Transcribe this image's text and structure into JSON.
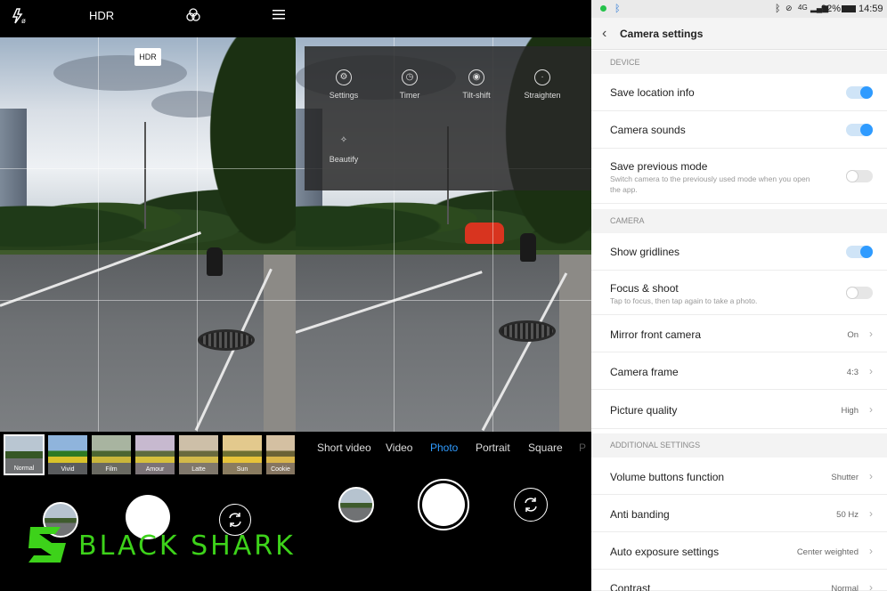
{
  "panel_left": {
    "topbar": {
      "flash_icon": "flash-auto-icon",
      "hdr_label": "HDR",
      "filter_icon": "filter-circles-icon",
      "menu_icon": "hamburger-menu-icon"
    },
    "hdr_badge": "HDR",
    "filters": [
      "Normal",
      "Vivid",
      "Film",
      "Amour",
      "Latte",
      "Sun",
      "Cookie"
    ],
    "selected_filter": "Normal",
    "brand": {
      "text": "BLACK SHARK",
      "color": "#3dd21a"
    }
  },
  "panel_middle": {
    "menu": {
      "items": [
        {
          "label": "Settings",
          "icon": "gear-icon"
        },
        {
          "label": "Timer",
          "icon": "clock-icon"
        },
        {
          "label": "Tilt-shift",
          "icon": "tilt-shift-icon"
        },
        {
          "label": "Straighten",
          "icon": "straighten-icon"
        },
        {
          "label": "Beautify",
          "icon": "sparkle-icon"
        }
      ]
    },
    "modes": [
      "Short video",
      "Video",
      "Photo",
      "Portrait",
      "Square",
      "P"
    ],
    "active_mode": "Photo",
    "accent": "#2f9bff"
  },
  "panel_right": {
    "statusbar": {
      "battery": "92%",
      "time": "14:59",
      "network": "4G"
    },
    "header": {
      "title": "Camera settings"
    },
    "sections": {
      "device": "DEVICE",
      "camera": "CAMERA",
      "additional": "ADDITIONAL SETTINGS"
    },
    "rows": {
      "save_location": {
        "label": "Save location info",
        "on": true
      },
      "camera_sounds": {
        "label": "Camera sounds",
        "on": true
      },
      "save_previous": {
        "label": "Save previous mode",
        "desc": "Switch camera to the previously used mode when you open the app.",
        "on": false
      },
      "gridlines": {
        "label": "Show gridlines",
        "on": true
      },
      "focus_shoot": {
        "label": "Focus & shoot",
        "desc": "Tap to focus, then tap again to take a photo.",
        "on": false
      },
      "mirror": {
        "label": "Mirror front camera",
        "value": "On"
      },
      "frame": {
        "label": "Camera frame",
        "value": "4:3"
      },
      "quality": {
        "label": "Picture quality",
        "value": "High"
      },
      "volume": {
        "label": "Volume buttons function",
        "value": "Shutter"
      },
      "anti_banding": {
        "label": "Anti banding",
        "value": "50 Hz"
      },
      "auto_exposure": {
        "label": "Auto exposure settings",
        "value": "Center weighted"
      },
      "contrast": {
        "label": "Contrast",
        "value": "Normal"
      }
    }
  }
}
